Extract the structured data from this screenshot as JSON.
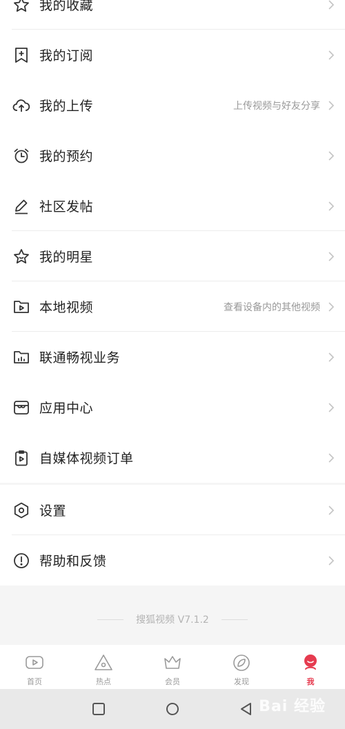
{
  "menu": {
    "items": [
      {
        "label": "我的收藏",
        "sub": "",
        "icon": "star-badge-icon"
      },
      {
        "label": "我的订阅",
        "sub": "",
        "icon": "bookmark-plus-icon"
      },
      {
        "label": "我的上传",
        "sub": "上传视频与好友分享",
        "icon": "cloud-upload-icon"
      },
      {
        "label": "我的预约",
        "sub": "",
        "icon": "alarm-clock-icon"
      },
      {
        "label": "社区发帖",
        "sub": "",
        "icon": "pencil-icon"
      },
      {
        "label": "我的明星",
        "sub": "",
        "icon": "star-face-icon"
      },
      {
        "label": "本地视频",
        "sub": "查看设备内的其他视频",
        "icon": "folder-play-icon"
      },
      {
        "label": "联通畅视业务",
        "sub": "",
        "icon": "folder-chart-icon"
      },
      {
        "label": "应用中心",
        "sub": "",
        "icon": "store-icon"
      },
      {
        "label": "自媒体视频订单",
        "sub": "",
        "icon": "clipboard-play-icon"
      },
      {
        "label": "设置",
        "sub": "",
        "icon": "hexagon-gear-icon"
      },
      {
        "label": "帮助和反馈",
        "sub": "",
        "icon": "exclamation-circle-icon"
      }
    ]
  },
  "version": "搜狐视频 V7.1.2",
  "tabs": [
    {
      "label": "首页",
      "icon": "home-play-icon",
      "active": false
    },
    {
      "label": "热点",
      "icon": "hotspot-triangle-icon",
      "active": false
    },
    {
      "label": "会员",
      "icon": "crown-icon",
      "active": false
    },
    {
      "label": "发现",
      "icon": "compass-leaf-icon",
      "active": false
    },
    {
      "label": "我",
      "icon": "profile-icon",
      "active": true
    }
  ],
  "colors": {
    "accent": "#e63b4f",
    "icon": "#333333",
    "subtext": "#999999"
  },
  "watermark": "Bai 经验"
}
